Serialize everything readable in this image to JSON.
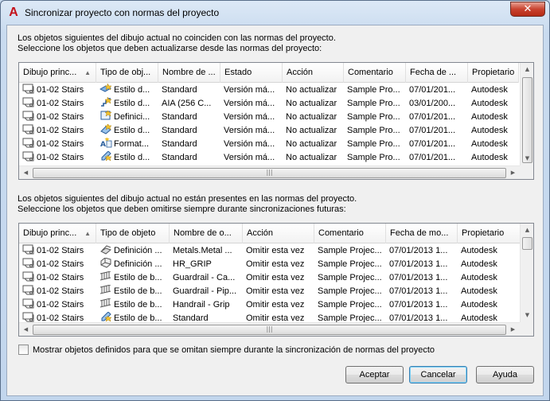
{
  "window": {
    "title": "Sincronizar proyecto con normas del proyecto",
    "app_icon": "autocad-a-icon",
    "close_glyph": "✕"
  },
  "top": {
    "desc_line1": "Los objetos siguientes del dibujo actual no coinciden con las normas del proyecto.",
    "desc_line2": "Seleccione los objetos que deben actualizarse desde las normas del proyecto:",
    "columns": [
      "Dibujo princ...",
      "Tipo de obj...",
      "Nombre de ...",
      "Estado",
      "Acción",
      "Comentario",
      "Fecha de ...",
      "Propietario"
    ],
    "rows": [
      {
        "icon": "wall-style-icon",
        "c": [
          "01-02 Stairs",
          "Estilo d...",
          "Standard",
          "Versión má...",
          "No actualizar",
          "Sample Pro...",
          "07/01/201...",
          "Autodesk"
        ]
      },
      {
        "icon": "stair-style-icon",
        "c": [
          "01-02 Stairs",
          "Estilo d...",
          "AIA (256 C...",
          "Versión má...",
          "No actualizar",
          "Sample Pro...",
          "03/01/200...",
          "Autodesk"
        ]
      },
      {
        "icon": "definition-icon",
        "c": [
          "01-02 Stairs",
          "Definici...",
          "Standard",
          "Versión má...",
          "No actualizar",
          "Sample Pro...",
          "07/01/201...",
          "Autodesk"
        ]
      },
      {
        "icon": "style-blue-icon",
        "c": [
          "01-02 Stairs",
          "Estilo d...",
          "Standard",
          "Versión má...",
          "No actualizar",
          "Sample Pro...",
          "07/01/201...",
          "Autodesk"
        ]
      },
      {
        "icon": "format-icon",
        "c": [
          "01-02 Stairs",
          "Format...",
          "Standard",
          "Versión má...",
          "No actualizar",
          "Sample Pro...",
          "07/01/201...",
          "Autodesk"
        ]
      },
      {
        "icon": "style-pencil-icon",
        "c": [
          "01-02 Stairs",
          "Estilo d...",
          "Standard",
          "Versión má...",
          "No actualizar",
          "Sample Pro...",
          "07/01/201...",
          "Autodesk"
        ]
      }
    ]
  },
  "bottom": {
    "desc_line1": "Los objetos siguientes del dibujo actual no están presentes en las normas del proyecto.",
    "desc_line2": "Seleccione los objetos que deben omitirse siempre durante sincronizaciones futuras:",
    "columns": [
      "Dibujo princ...",
      "Tipo de objeto",
      "Nombre de o...",
      "Acción",
      "Comentario",
      "Fecha de mo...",
      "Propietario"
    ],
    "rows": [
      {
        "icon": "curtain-wall-icon",
        "c": [
          "01-02 Stairs",
          "Definición ...",
          "Metals.Metal ...",
          "Omitir esta vez",
          "Sample Projec...",
          "07/01/2013 1...",
          "Autodesk"
        ]
      },
      {
        "icon": "grip-icon",
        "c": [
          "01-02 Stairs",
          "Definición ...",
          "HR_GRIP",
          "Omitir esta vez",
          "Sample Projec...",
          "07/01/2013 1...",
          "Autodesk"
        ]
      },
      {
        "icon": "railing-icon",
        "c": [
          "01-02 Stairs",
          "Estilo de b...",
          "Guardrail - Ca...",
          "Omitir esta vez",
          "Sample Projec...",
          "07/01/2013 1...",
          "Autodesk"
        ]
      },
      {
        "icon": "railing-icon",
        "c": [
          "01-02 Stairs",
          "Estilo de b...",
          "Guardrail - Pip...",
          "Omitir esta vez",
          "Sample Projec...",
          "07/01/2013 1...",
          "Autodesk"
        ]
      },
      {
        "icon": "railing-icon",
        "c": [
          "01-02 Stairs",
          "Estilo de b...",
          "Handrail - Grip",
          "Omitir esta vez",
          "Sample Projec...",
          "07/01/2013 1...",
          "Autodesk"
        ]
      },
      {
        "icon": "style-pencil-icon",
        "c": [
          "01-02 Stairs",
          "Estilo de b...",
          "Standard",
          "Omitir esta vez",
          "Sample Projec...",
          "07/01/2013 1...",
          "Autodesk"
        ]
      }
    ]
  },
  "checkbox": {
    "label": "Mostrar objetos definidos para que se omitan siempre durante la sincronización de normas del proyecto",
    "checked": false
  },
  "buttons": {
    "accept": "Aceptar",
    "cancel": "Cancelar",
    "help": "Ayuda"
  },
  "scroll": {
    "left": "◀",
    "right": "▶",
    "up": "▲",
    "down": "▼",
    "grip": "|||"
  },
  "sort_indicator": "▲"
}
